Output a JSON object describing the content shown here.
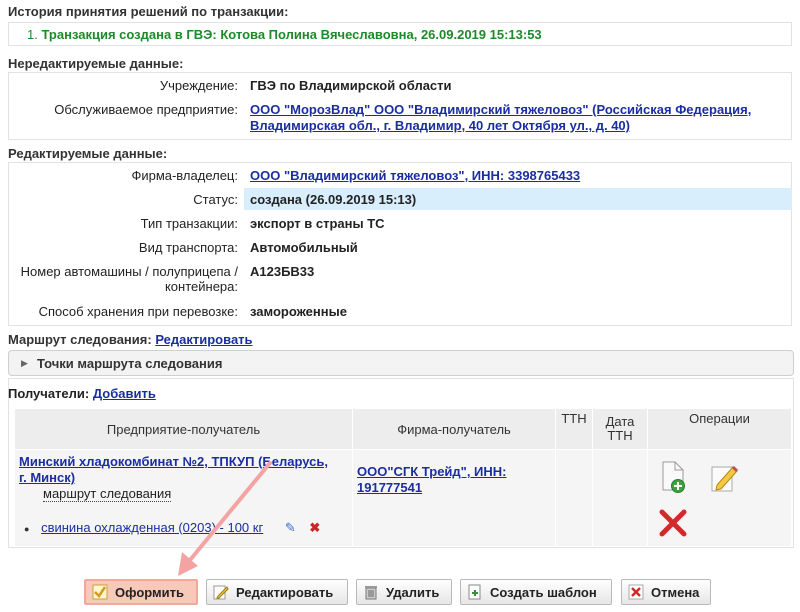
{
  "history": {
    "title": "История принятия решений по транзакции:",
    "num": "1.",
    "entry": "Транзакция создана в ГВЭ: Котова Полина Вячеславовна, 26.09.2019 15:13:53"
  },
  "readonly": {
    "title": "Нередактируемые данные:",
    "institution_label": "Учреждение:",
    "institution_value": "ГВЭ по Владимирской области",
    "enterprise_label": "Обслуживаемое предприятие:",
    "enterprise_line1": "ООО \"МорозВлад\" ООО \"Владимирский тяжеловоз\" (Российская Федерация,",
    "enterprise_line2": "Владимирская обл., г. Владимир, 40 лет Октября ул., д. 40)"
  },
  "editable": {
    "title": "Редактируемые данные:",
    "owner_label": "Фирма-владелец:",
    "owner_value": "ООО \"Владимирский тяжеловоз\", ИНН: 3398765433",
    "status_label": "Статус:",
    "status_value": "создана (26.09.2019 15:13)",
    "type_label": "Тип транзакции:",
    "type_value": "экспорт в страны ТС",
    "transport_label": "Вид транспорта:",
    "transport_value": "Автомобильный",
    "vehicle_label_1": "Номер автомашины / полуприцепа /",
    "vehicle_label_2": "контейнера:",
    "vehicle_value": "А123БВ33",
    "storage_label": "Способ хранения при перевозке:",
    "storage_value": "замороженные"
  },
  "route": {
    "title": "Маршрут следования:",
    "edit_link": "Редактировать",
    "points_label": "Точки маршрута следования"
  },
  "recipients": {
    "title": "Получатели:",
    "add_link": "Добавить",
    "headers": {
      "enterprise": "Предприятие-получатель",
      "firm": "Фирма-получатель",
      "ttn": "ТТН",
      "ttn_date_1": "Дата",
      "ttn_date_2": "ТТН",
      "ops": "Операции"
    },
    "row": {
      "enterprise_1": "Минский хладокомбинат №2, ТПКУП (Беларусь,",
      "enterprise_2": "г. Минск)",
      "route_note": "маршрут следования",
      "firm_1": "ООО\"СГК Трейд\", ИНН:",
      "firm_2": "191777541"
    },
    "product": "свинина охлажденная (0203) - 100 кг"
  },
  "buttons": {
    "issue": "Оформить",
    "edit": "Редактировать",
    "delete": "Удалить",
    "template": "Создать шаблон",
    "cancel": "Отмена"
  },
  "colors": {
    "link": "#1a2ea0",
    "history_green": "#1d8a2a",
    "status_highlight": "#d8eefc",
    "primary_button": "#f7c9b9",
    "arrow": "#f08a8a"
  }
}
